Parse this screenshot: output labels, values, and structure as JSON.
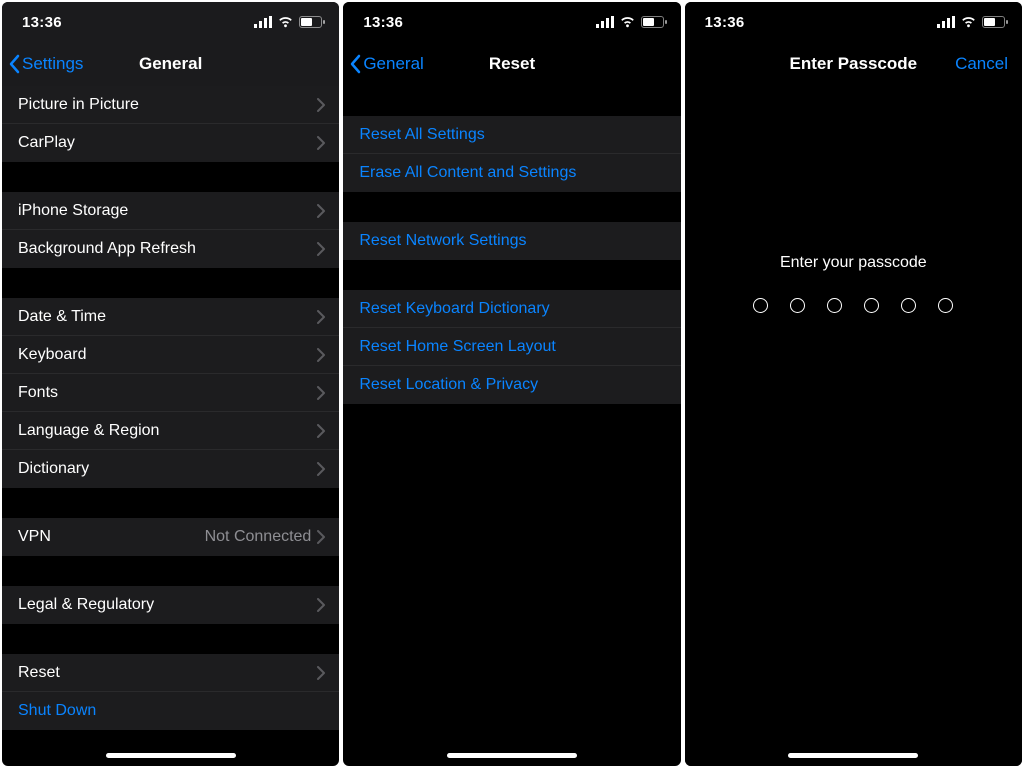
{
  "status": {
    "time": "13:36"
  },
  "screens": {
    "general": {
      "back": "Settings",
      "title": "General",
      "rows": {
        "pip": "Picture in Picture",
        "carplay": "CarPlay",
        "storage": "iPhone Storage",
        "bgapp": "Background App Refresh",
        "datetime": "Date & Time",
        "keyboard": "Keyboard",
        "fonts": "Fonts",
        "lang": "Language & Region",
        "dict": "Dictionary",
        "vpn": "VPN",
        "vpn_detail": "Not Connected",
        "legal": "Legal & Regulatory",
        "reset": "Reset",
        "shutdown": "Shut Down"
      }
    },
    "reset": {
      "back": "General",
      "title": "Reset",
      "rows": {
        "reset_all": "Reset All Settings",
        "erase_all": "Erase All Content and Settings",
        "reset_network": "Reset Network Settings",
        "reset_keyboard": "Reset Keyboard Dictionary",
        "reset_home": "Reset Home Screen Layout",
        "reset_location": "Reset Location & Privacy"
      }
    },
    "passcode": {
      "title": "Enter Passcode",
      "cancel": "Cancel",
      "prompt": "Enter your passcode",
      "digit_count": 6
    }
  }
}
